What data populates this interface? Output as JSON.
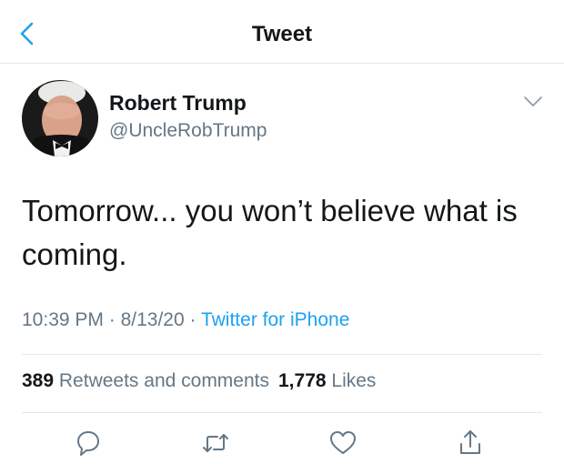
{
  "header": {
    "title": "Tweet",
    "back_icon": "chevron-left-icon",
    "accent_color": "#1da1f2"
  },
  "author": {
    "display_name": "Robert Trump",
    "handle": "@UncleRobTrump",
    "menu_icon": "chevron-down-icon"
  },
  "tweet": {
    "text": "Tomorrow... you won’t believe what is coming."
  },
  "meta": {
    "time": "10:39 PM",
    "date": "8/13/20",
    "source": "Twitter for iPhone",
    "separator": "·"
  },
  "stats": {
    "retweets_count": "389",
    "retweets_label": "Retweets and comments",
    "likes_count": "1,778",
    "likes_label": "Likes"
  },
  "actions": [
    {
      "icon": "reply-icon"
    },
    {
      "icon": "retweet-icon"
    },
    {
      "icon": "heart-icon"
    },
    {
      "icon": "share-icon"
    }
  ]
}
